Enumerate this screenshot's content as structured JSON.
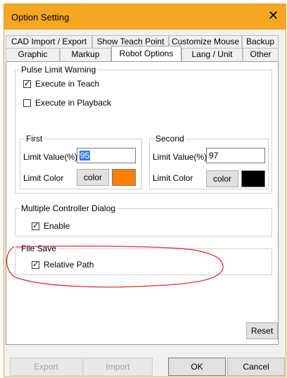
{
  "window": {
    "title": "Option Setting",
    "close_glyph": "✕"
  },
  "tabs": {
    "row1": [
      "CAD  Import / Export",
      "Show Teach Point",
      "Customize Mouse",
      "Backup"
    ],
    "row2": [
      "Graphic",
      "Markup",
      "Robot Options",
      "Lang / Unit",
      "Other"
    ],
    "active": "Robot Options"
  },
  "pulse_limit": {
    "title": "Pulse Limit Warning",
    "execute_teach": {
      "label": "Execute in Teach",
      "checked": true
    },
    "execute_playback": {
      "label": "Execute in Playback",
      "checked": false
    },
    "first": {
      "title": "First",
      "limit_value_label": "Limit Value(%)",
      "limit_value": "95",
      "limit_color_label": "Limit Color",
      "color_button": "color",
      "color": "#ff8000"
    },
    "second": {
      "title": "Second",
      "limit_value_label": "Limit Value(%)",
      "limit_value": "97",
      "limit_color_label": "Limit Color",
      "color_button": "color",
      "color": "#000000"
    }
  },
  "multi_controller": {
    "title": "Multiple Controller Dialog",
    "enable": {
      "label": "Enable",
      "checked": true
    }
  },
  "file_save": {
    "title": "File Save",
    "relative_path": {
      "label": "Relative Path",
      "checked": true
    }
  },
  "buttons": {
    "reset": "Reset",
    "export": "Export",
    "import": "Import",
    "ok": "OK",
    "cancel": "Cancel"
  },
  "colors": {
    "titlebar": "#f5a623",
    "annotation": "#e03030"
  }
}
